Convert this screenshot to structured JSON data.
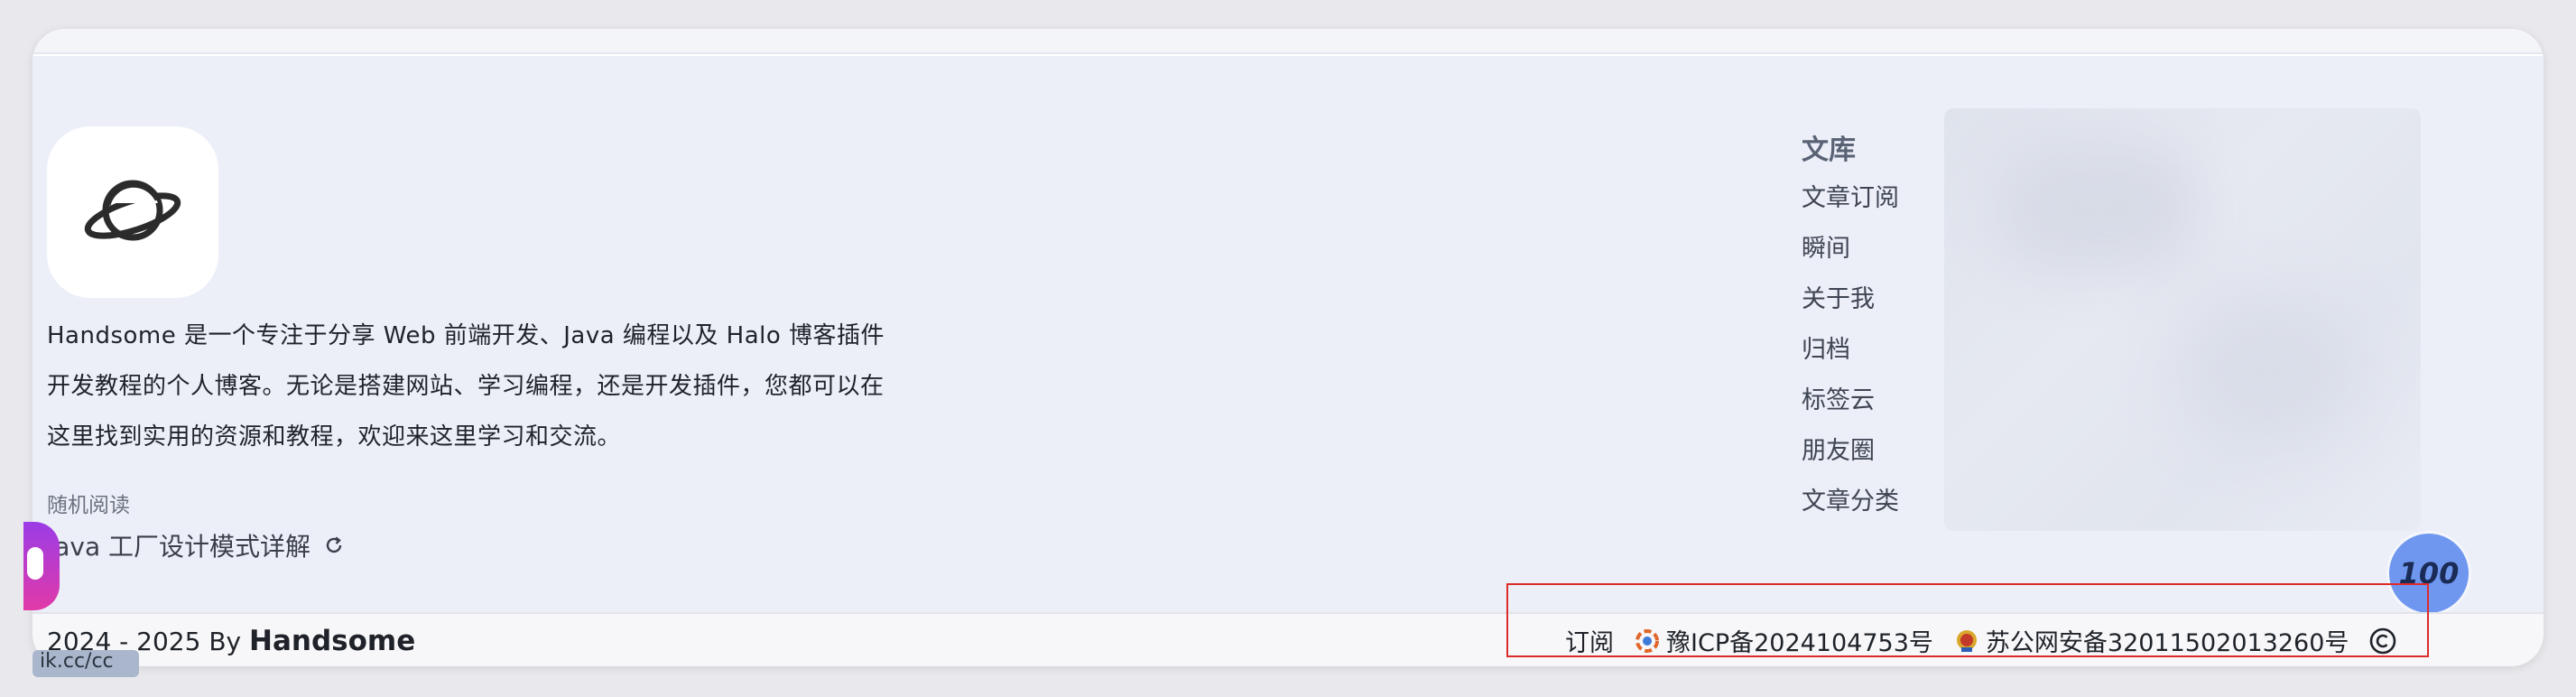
{
  "site": {
    "intro_lines": [
      "Handsome 是一个专注于分享 Web 前端开发、Java 编程以及 Halo 博客插件",
      "开发教程的个人博客。无论是搭建网站、学习编程，还是开发插件，您都可以在",
      "这里找到实用的资源和教程，欢迎来这里学习和交流。"
    ],
    "logo_icon": "planet-icon"
  },
  "random_read": {
    "label": "随机阅读",
    "article_title": "Java 工厂设计模式详解",
    "refresh_icon": "refresh-icon"
  },
  "nav": {
    "title": "文库",
    "items": [
      {
        "label": "文章订阅"
      },
      {
        "label": "瞬间"
      },
      {
        "label": "关于我"
      },
      {
        "label": "归档"
      },
      {
        "label": "标签云"
      },
      {
        "label": "朋友圈"
      },
      {
        "label": "文章分类"
      }
    ]
  },
  "score_badge": "100",
  "footer": {
    "years": "2024 - 2025 By",
    "author": "Handsome",
    "subscribe": "订阅",
    "icp": "豫ICP备2024104753号",
    "police": "苏公网安备32011502013260号",
    "copyright_icon": "copyright-icon"
  },
  "left_tag": "ik.cc/cc",
  "colors": {
    "main_bg": "#eceff8",
    "footer_bg": "#f7f7f9",
    "annotation": "#dd2b2b",
    "badge": "#6f97f0"
  }
}
